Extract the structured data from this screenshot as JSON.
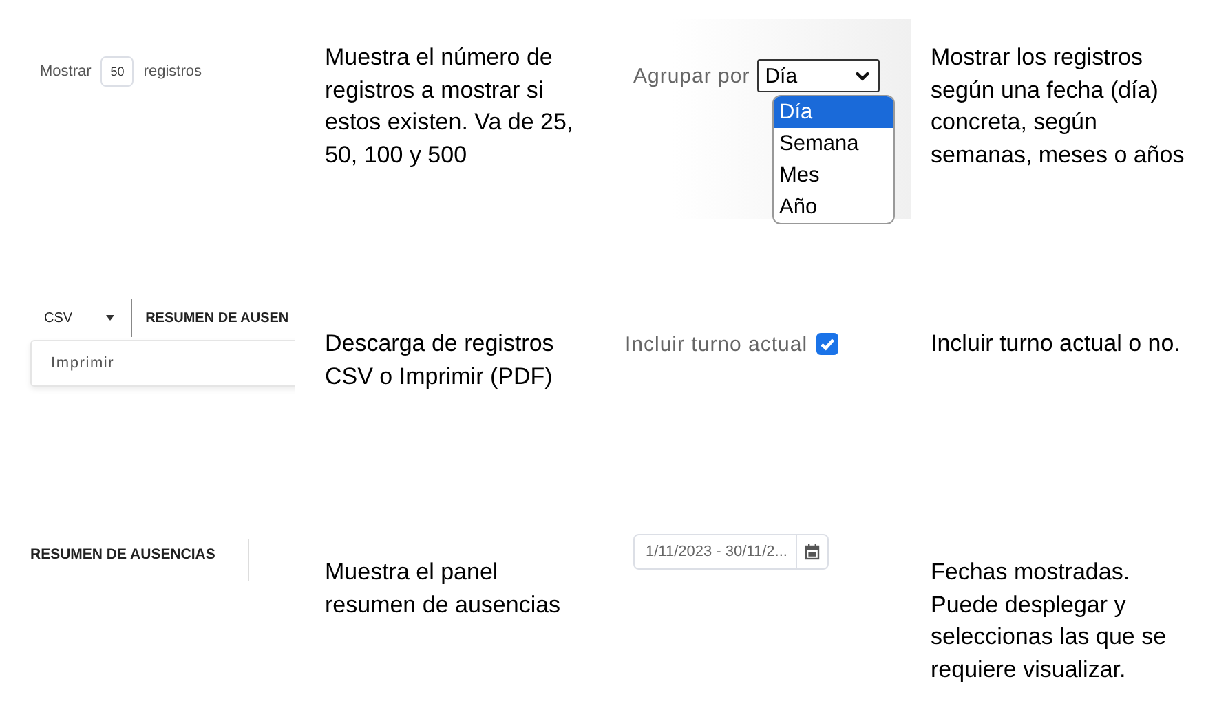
{
  "sections": [
    {
      "kind": "page_size",
      "label_before": "Mostrar",
      "value": "50",
      "label_after": "registros",
      "description": "Muestra el número de registros a mostrar si estos existen. Va de 25, 50, 100 y 500"
    },
    {
      "kind": "group_by",
      "label": "Agrupar por",
      "value": "Día",
      "options": [
        {
          "label": "Día",
          "selected": true
        },
        {
          "label": "Semana",
          "selected": false
        },
        {
          "label": "Mes",
          "selected": false
        },
        {
          "label": "Año",
          "selected": false
        }
      ],
      "description": "Mostrar los registros según una fecha (día) concreta, según semanas, meses o años"
    },
    {
      "kind": "export",
      "button": "CSV",
      "next_button": "RESUMEN DE AUSEN",
      "menu": [
        "Imprimir"
      ],
      "description": "Descarga de registros CSV o Imprimir (PDF)"
    },
    {
      "kind": "checkbox",
      "label": "Incluir turno actual",
      "checked": true,
      "description": "Incluir turno actual o no."
    },
    {
      "kind": "summary_button",
      "button": "RESUMEN DE AUSENCIAS",
      "description": "Muestra el panel resumen de ausencias"
    },
    {
      "kind": "date_range",
      "value": "1/11/2023 - 30/11/2...",
      "description": "Fechas mostradas. Puede desplegar y seleccionas las que se requiere visualizar."
    }
  ]
}
